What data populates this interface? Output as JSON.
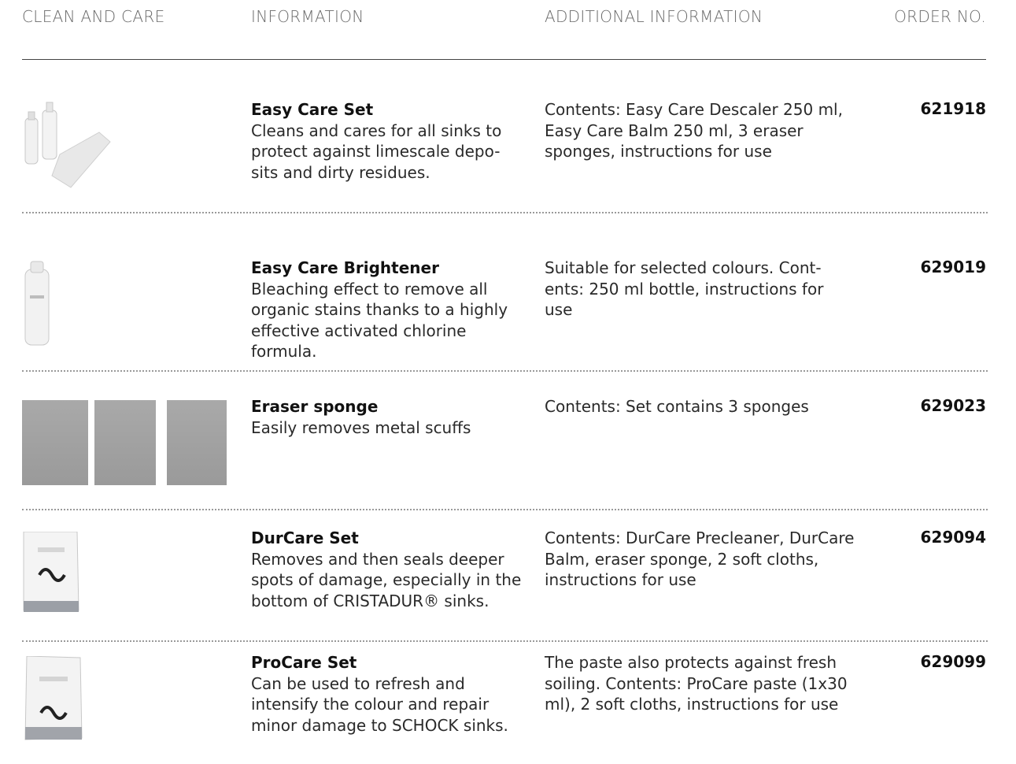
{
  "headers": {
    "col1": "CLEAN AND CARE",
    "col2": "INFORMATION",
    "col3": "ADDITIONAL INFORMATION",
    "col4": "ORDER NO."
  },
  "products": [
    {
      "name": "Easy Care Set",
      "description": "Cleans and cares for all sinks to protect against limescale depo-sits and dirty residues.",
      "additional": "Contents: Easy Care Descaler 250 ml, Easy Care Balm 250 ml, 3 eraser sponges, instructions for use",
      "order_no": "621918",
      "image_icon": "easy-care-set-product-image"
    },
    {
      "name": "Easy Care Brightener",
      "description": "Bleaching effect to remove all organic stains thanks to a highly effective activated chlorine formula.",
      "additional": "Suitable for selected colours. Cont-ents: 250 ml bottle, instructions for use",
      "order_no": "629019",
      "image_icon": "bottle-product-image"
    },
    {
      "name": "Eraser sponge",
      "description": "Easily removes metal scuffs",
      "additional": "Contents: Set contains 3 sponges",
      "order_no": "629023",
      "image_icon": "sponges-product-image"
    },
    {
      "name": "DurCare Set",
      "description": "Removes and then seals deeper spots of damage, especially in the bottom of CRISTADUR® sinks.",
      "additional": "Contents: DurCare Precleaner, DurCare Balm, eraser sponge, 2 soft cloths, instructions for use",
      "order_no": "629094",
      "image_icon": "durcare-box-product-image"
    },
    {
      "name": "ProCare Set",
      "description": "Can be used to refresh and intensify the colour and repair minor damage to SCHOCK sinks.",
      "additional": "The paste also protects against fresh soiling. Contents: ProCare paste (1x30 ml), 2 soft cloths, instructions for use",
      "order_no": "629099",
      "image_icon": "procare-box-product-image"
    }
  ]
}
